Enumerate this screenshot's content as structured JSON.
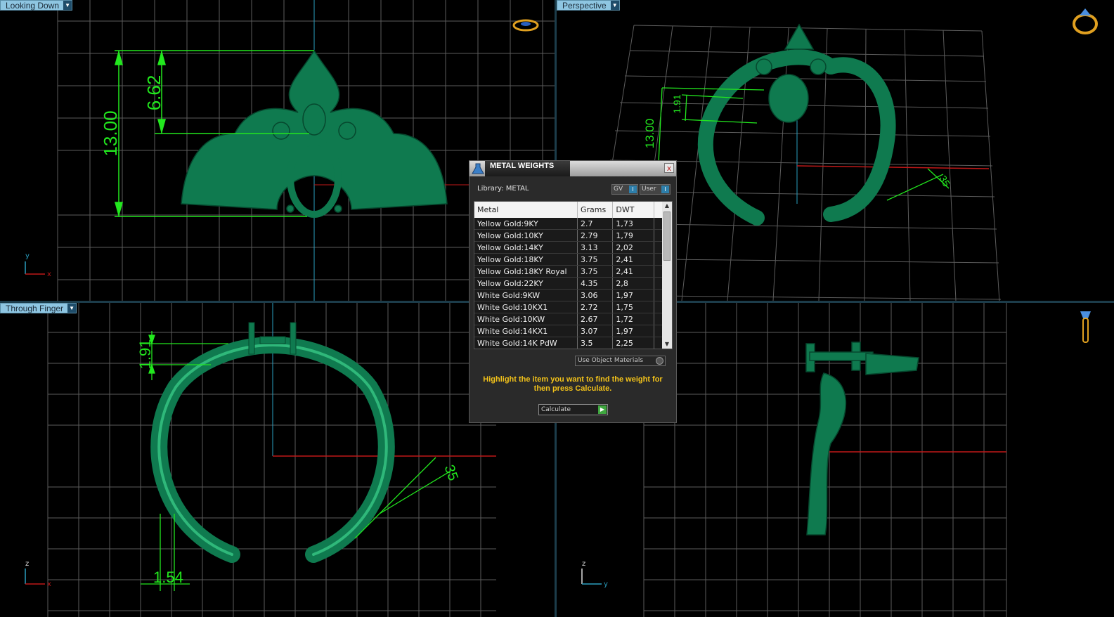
{
  "viewports": {
    "top_left": {
      "label": "Looking Down",
      "dims": {
        "a": "13.00",
        "b": "6.62"
      },
      "axes": {
        "v": "y",
        "h": "x"
      }
    },
    "top_right": {
      "label": "Perspective",
      "dims": {
        "a": "13.00",
        "b": "1.91",
        "c": "35"
      }
    },
    "bottom_left": {
      "label": "Through Finger",
      "dims": {
        "a": "1.91",
        "b": "35",
        "c": "1.54"
      },
      "axes": {
        "v": "z",
        "h": "x"
      }
    },
    "bottom_right": {
      "label": "",
      "axes": {
        "v": "z",
        "h": "y"
      }
    }
  },
  "dialog": {
    "title": "METAL WEIGHTS",
    "close": "x",
    "library_label": "Library: METAL",
    "gv_button": "GV",
    "user_button": "User",
    "columns": {
      "metal": "Metal",
      "grams": "Grams",
      "dwt": "DWT"
    },
    "rows": [
      {
        "metal": "Yellow Gold:9KY",
        "grams": "2.7",
        "dwt": "1,73"
      },
      {
        "metal": "Yellow Gold:10KY",
        "grams": "2.79",
        "dwt": "1,79"
      },
      {
        "metal": "Yellow Gold:14KY",
        "grams": "3.13",
        "dwt": "2,02"
      },
      {
        "metal": "Yellow Gold:18KY",
        "grams": "3.75",
        "dwt": "2,41"
      },
      {
        "metal": "Yellow Gold:18KY Royal",
        "grams": "3.75",
        "dwt": "2,41"
      },
      {
        "metal": "Yellow Gold:22KY",
        "grams": "4.35",
        "dwt": "2,8"
      },
      {
        "metal": "White Gold:9KW",
        "grams": "3.06",
        "dwt": "1,97"
      },
      {
        "metal": "White Gold:10KX1",
        "grams": "2.72",
        "dwt": "1,75"
      },
      {
        "metal": "White Gold:10KW",
        "grams": "2.67",
        "dwt": "1,72"
      },
      {
        "metal": "White Gold:14KX1",
        "grams": "3.07",
        "dwt": "1,97"
      },
      {
        "metal": "White Gold:14K PdW",
        "grams": "3.5",
        "dwt": "2,25"
      }
    ],
    "use_object_materials": "Use Object Materials",
    "hint": "Highlight the item you want to find the weight for then press Calculate.",
    "calculate_button": "Calculate"
  },
  "colors": {
    "grid": "#6a6a6a",
    "model": "#0f7a4f",
    "dimension": "#22e81e",
    "accent": "#8ec6e2",
    "hint": "#f2c21a"
  }
}
